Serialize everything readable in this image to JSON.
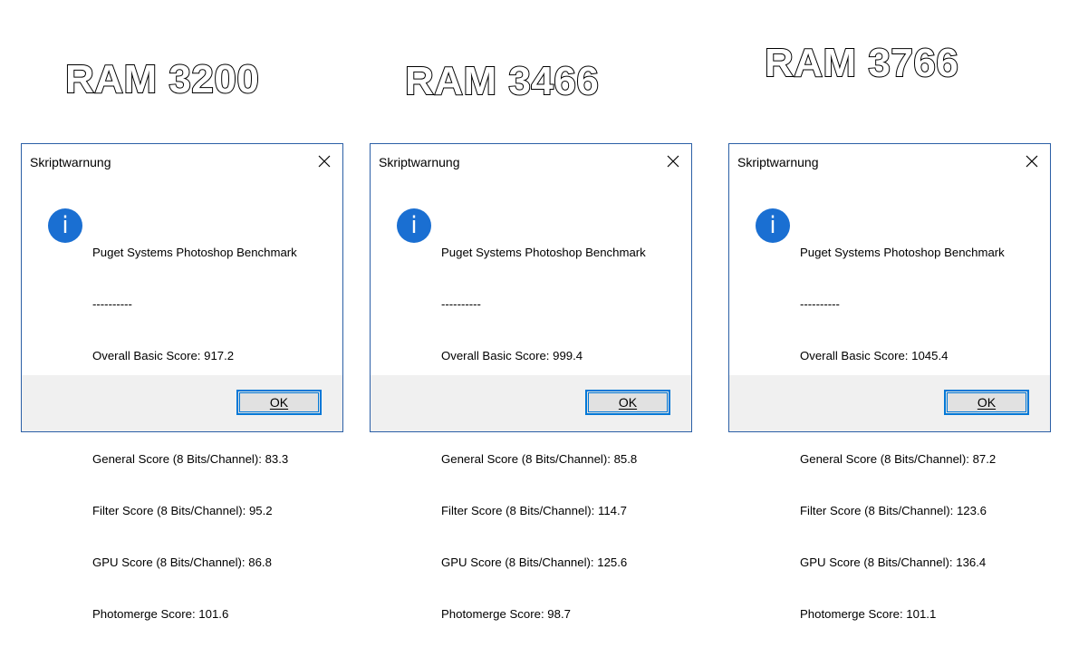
{
  "panels": [
    {
      "heading": "RAM 3200",
      "dialog": {
        "title": "Skriptwarnung",
        "icon": "info-icon",
        "lines": [
          "Puget Systems Photoshop Benchmark",
          "----------",
          "Overall Basic Score: 917.2",
          "----------",
          "General Score (8 Bits/Channel): 83.3",
          "Filter Score (8 Bits/Channel): 95.2",
          "GPU Score (8 Bits/Channel): 86.8",
          "Photomerge Score: 101.6"
        ],
        "ok_label": "OK"
      }
    },
    {
      "heading": "RAM 3466",
      "dialog": {
        "title": "Skriptwarnung",
        "icon": "info-icon",
        "lines": [
          "Puget Systems Photoshop Benchmark",
          "----------",
          "Overall Basic Score: 999.4",
          "----------",
          "General Score (8 Bits/Channel): 85.8",
          "Filter Score (8 Bits/Channel): 114.7",
          "GPU Score (8 Bits/Channel): 125.6",
          "Photomerge Score: 98.7"
        ],
        "ok_label": "OK"
      }
    },
    {
      "heading": "RAM 3766",
      "dialog": {
        "title": "Skriptwarnung",
        "icon": "info-icon",
        "lines": [
          "Puget Systems Photoshop Benchmark",
          "----------",
          "Overall Basic Score: 1045.4",
          "----------",
          "General Score (8 Bits/Channel): 87.2",
          "Filter Score (8 Bits/Channel): 123.6",
          "GPU Score (8 Bits/Channel): 136.4",
          "Photomerge Score: 101.1"
        ],
        "ok_label": "OK"
      }
    }
  ],
  "colors": {
    "dialog_border": "#2b5fa6",
    "info_icon": "#1a6fd2",
    "footer_bg": "#f0f0f0",
    "button_bg": "#e1e1e1",
    "button_focus": "#0078d7"
  }
}
